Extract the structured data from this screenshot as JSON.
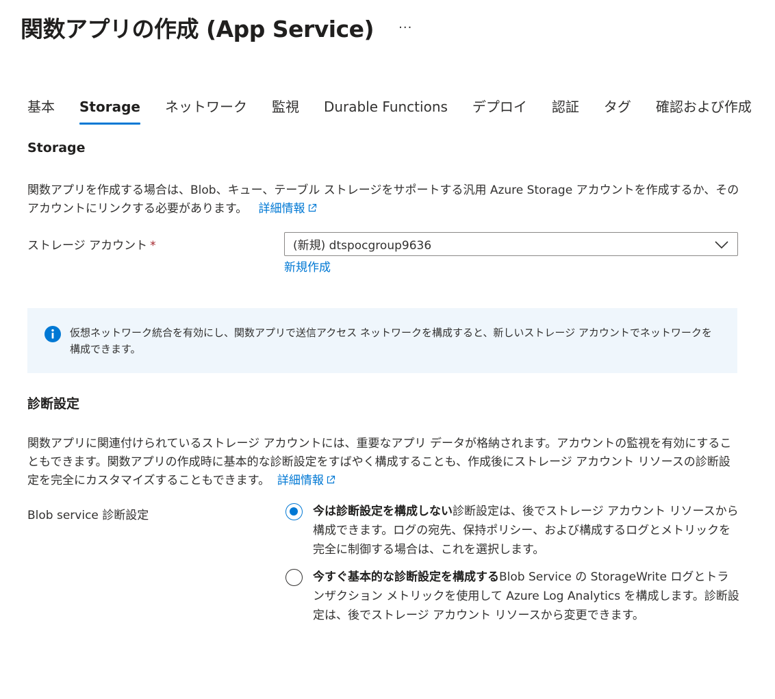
{
  "header": {
    "title": "関数アプリの作成 (App Service)",
    "more_label": "···"
  },
  "tabs": [
    {
      "label": "基本",
      "active": false
    },
    {
      "label": "Storage",
      "active": true
    },
    {
      "label": "ネットワーク",
      "active": false
    },
    {
      "label": "監視",
      "active": false
    },
    {
      "label": "Durable Functions",
      "active": false
    },
    {
      "label": "デプロイ",
      "active": false
    },
    {
      "label": "認証",
      "active": false
    },
    {
      "label": "タグ",
      "active": false
    },
    {
      "label": "確認および作成",
      "active": false
    }
  ],
  "storage": {
    "heading": "Storage",
    "description": "関数アプリを作成する場合は、Blob、キュー、テーブル ストレージをサポートする汎用 Azure Storage アカウントを作成するか、そのアカウントにリンクする必要があります。",
    "learn_more": "詳細情報",
    "account_label": "ストレージ アカウント",
    "required_mark": "*",
    "account_value": "(新規) dtspocgroup9636",
    "create_new": "新規作成"
  },
  "info": {
    "text": "仮想ネットワーク統合を有効にし、関数アプリで送信アクセス ネットワークを構成すると、新しいストレージ アカウントでネットワークを構成できます。",
    "icon": "info-icon"
  },
  "diagnostics": {
    "heading": "診断設定",
    "description": "関数アプリに関連付けられているストレージ アカウントには、重要なアプリ データが格納されます。アカウントの監視を有効にすることもできます。関数アプリの作成時に基本的な診断設定をすばやく構成することも、作成後にストレージ アカウント リソースの診断設定を完全にカスタマイズすることもできます。",
    "learn_more": "詳細情報",
    "blob_label": "Blob service 診断設定",
    "options": [
      {
        "bold": "今は診断設定を構成しない",
        "text": "診断設定は、後でストレージ アカウント リソースから構成できます。ログの宛先、保持ポリシー、および構成するログとメトリックを完全に制御する場合は、これを選択します。",
        "selected": true
      },
      {
        "bold": "今すぐ基本的な診断設定を構成する",
        "text": "Blob Service の StorageWrite ログとトランザクション メトリックを使用して Azure Log Analytics を構成します。診断設定は、後でストレージ アカウント リソースから変更できます。",
        "selected": false
      }
    ]
  },
  "colors": {
    "accent": "#0078d4",
    "info_background": "#eff6fc",
    "required": "#a4262c"
  }
}
